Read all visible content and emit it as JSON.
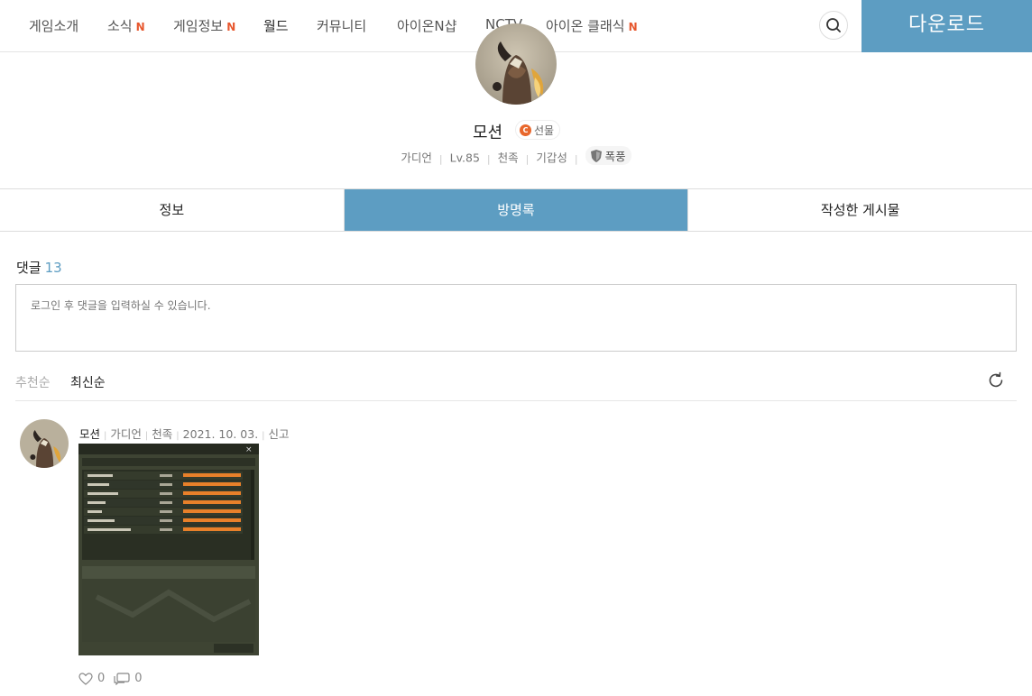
{
  "nav": {
    "items": [
      {
        "label": "게임소개",
        "new": ""
      },
      {
        "label": "소식",
        "new": "N"
      },
      {
        "label": "게임정보",
        "new": "N"
      },
      {
        "label": "월드",
        "new": ""
      },
      {
        "label": "커뮤니티",
        "new": ""
      },
      {
        "label": "아이온N샵",
        "new": ""
      },
      {
        "label": "NCTV",
        "new": ""
      },
      {
        "label": "아이온 클래식",
        "new": "N"
      }
    ],
    "search_icon": "search-icon",
    "download_label": "다운로드"
  },
  "profile": {
    "name": "모션",
    "gift_label": "선물",
    "gift_coin": "C",
    "class": "가디언",
    "level": "Lv.85",
    "race": "천족",
    "server": "기갑성",
    "legion": "폭풍"
  },
  "tabs": [
    {
      "label": "정보"
    },
    {
      "label": "방명록"
    },
    {
      "label": "작성한 게시물"
    }
  ],
  "comments": {
    "heading": "댓글",
    "count": "13",
    "input_placeholder": "로그인 후 댓글을 입력하실 수 있습니다.",
    "sort": {
      "popular": "추천순",
      "latest": "최신순"
    },
    "items": [
      {
        "author": "모션",
        "class": "가디언",
        "race": "천족",
        "date": "2021. 10. 03.",
        "report_label": "신고",
        "likes": "0",
        "replies": "0"
      }
    ]
  },
  "colors": {
    "accent": "#5d9dc2",
    "new_badge": "#e7572e"
  }
}
